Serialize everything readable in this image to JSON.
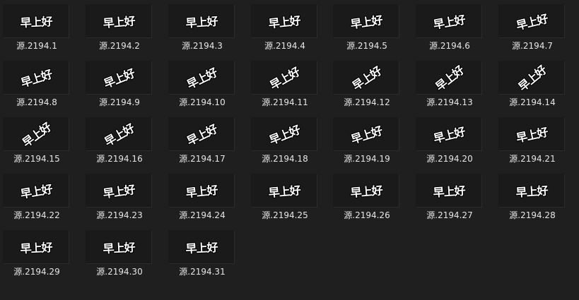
{
  "files": [
    {
      "name": "源.2194.1",
      "thumb_text": "早上好",
      "rotation_deg": -3
    },
    {
      "name": "源.2194.2",
      "thumb_text": "早上好",
      "rotation_deg": -5
    },
    {
      "name": "源.2194.3",
      "thumb_text": "早上好",
      "rotation_deg": -4
    },
    {
      "name": "源.2194.4",
      "thumb_text": "早上好",
      "rotation_deg": -6
    },
    {
      "name": "源.2194.5",
      "thumb_text": "早上好",
      "rotation_deg": -8
    },
    {
      "name": "源.2194.6",
      "thumb_text": "早上好",
      "rotation_deg": -10
    },
    {
      "name": "源.2194.7",
      "thumb_text": "早上好",
      "rotation_deg": -14
    },
    {
      "name": "源.2194.8",
      "thumb_text": "早上好",
      "rotation_deg": -18
    },
    {
      "name": "源.2194.9",
      "thumb_text": "早上好",
      "rotation_deg": -22
    },
    {
      "name": "源.2194.10",
      "thumb_text": "早上好",
      "rotation_deg": -26
    },
    {
      "name": "源.2194.11",
      "thumb_text": "早上好",
      "rotation_deg": -30
    },
    {
      "name": "源.2194.12",
      "thumb_text": "早上好",
      "rotation_deg": -34
    },
    {
      "name": "源.2194.13",
      "thumb_text": "早上好",
      "rotation_deg": -38
    },
    {
      "name": "源.2194.14",
      "thumb_text": "早上好",
      "rotation_deg": -40
    },
    {
      "name": "源.2194.15",
      "thumb_text": "早上好",
      "rotation_deg": -36
    },
    {
      "name": "源.2194.16",
      "thumb_text": "早上好",
      "rotation_deg": -30
    },
    {
      "name": "源.2194.17",
      "thumb_text": "早上好",
      "rotation_deg": -26
    },
    {
      "name": "源.2194.18",
      "thumb_text": "早上好",
      "rotation_deg": -22
    },
    {
      "name": "源.2194.19",
      "thumb_text": "早上好",
      "rotation_deg": -18
    },
    {
      "name": "源.2194.20",
      "thumb_text": "早上好",
      "rotation_deg": -14
    },
    {
      "name": "源.2194.21",
      "thumb_text": "早上好",
      "rotation_deg": -12
    },
    {
      "name": "源.2194.22",
      "thumb_text": "早上好",
      "rotation_deg": -10
    },
    {
      "name": "源.2194.23",
      "thumb_text": "早上好",
      "rotation_deg": -8
    },
    {
      "name": "源.2194.24",
      "thumb_text": "早上好",
      "rotation_deg": -6
    },
    {
      "name": "源.2194.25",
      "thumb_text": "早上好",
      "rotation_deg": -5
    },
    {
      "name": "源.2194.26",
      "thumb_text": "早上好",
      "rotation_deg": -5
    },
    {
      "name": "源.2194.27",
      "thumb_text": "早上好",
      "rotation_deg": -4
    },
    {
      "name": "源.2194.28",
      "thumb_text": "早上好",
      "rotation_deg": -4
    },
    {
      "name": "源.2194.29",
      "thumb_text": "早上好",
      "rotation_deg": -3
    },
    {
      "name": "源.2194.30",
      "thumb_text": "早上好",
      "rotation_deg": -3
    },
    {
      "name": "源.2194.31",
      "thumb_text": "早上好",
      "rotation_deg": -3
    }
  ]
}
